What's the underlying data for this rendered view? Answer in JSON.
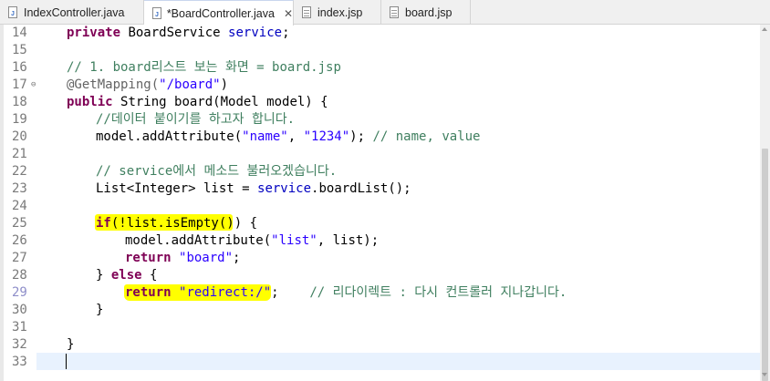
{
  "tabs": [
    {
      "label": "IndexController.java"
    },
    {
      "label": "*BoardController.java"
    },
    {
      "label": "index.jsp"
    },
    {
      "label": "board.jsp"
    }
  ],
  "tab_close_glyph": "✕",
  "line_numbers": [
    "14",
    "15",
    "16",
    "17",
    "18",
    "19",
    "20",
    "21",
    "22",
    "23",
    "24",
    "25",
    "26",
    "27",
    "28",
    "29",
    "30",
    "31",
    "32",
    "33"
  ],
  "fold_marker": "⊖",
  "code": {
    "l14": {
      "kw": "private",
      "type": "BoardService",
      "field": "service",
      "end": ";"
    },
    "l16": {
      "comment": "// 1. board리스트 보는 화면 = board.jsp"
    },
    "l17": {
      "ann": "@GetMapping(",
      "str": "\"/board\"",
      "end": ")"
    },
    "l18": {
      "kw": "public",
      "rest": "String board(Model model) {"
    },
    "l19": {
      "comment": "//데이터 붙이기를 하고자 합니다."
    },
    "l20": {
      "pre": "model.addAttribute(",
      "str1": "\"name\"",
      "mid": ", ",
      "str2": "\"1234\"",
      "end": ");",
      "comment": "// name, value"
    },
    "l22": {
      "comment": "// service에서 메소드 불러오겠습니다."
    },
    "l23": {
      "pre": "List<Integer> list = ",
      "field": "service",
      "end": ".boardList();"
    },
    "l25": {
      "kw": "if",
      "cond": "(!list.isEmpty())",
      "end": " {"
    },
    "l26": {
      "pre": "model.addAttribute(",
      "str": "\"list\"",
      "end": ", list);"
    },
    "l27": {
      "kw": "return",
      "str": "\"board\"",
      "end": ";"
    },
    "l28": {
      "pre": "} ",
      "kw": "else",
      "end": " {"
    },
    "l29": {
      "kw": "return",
      "str": "\"redirect:/\"",
      "end": ";",
      "comment": "// 리다이렉트 : 다시 컨트롤러 지나갑니다."
    },
    "l30": {
      "text": "}"
    },
    "l32": {
      "text": "}"
    }
  },
  "colors": {
    "keyword": "#7f0055",
    "field": "#0000c0",
    "string": "#2a00ff",
    "comment": "#3f7f5f",
    "annotation": "#646464",
    "highlight": "#ffff00",
    "current_line": "#e8f2fe"
  }
}
